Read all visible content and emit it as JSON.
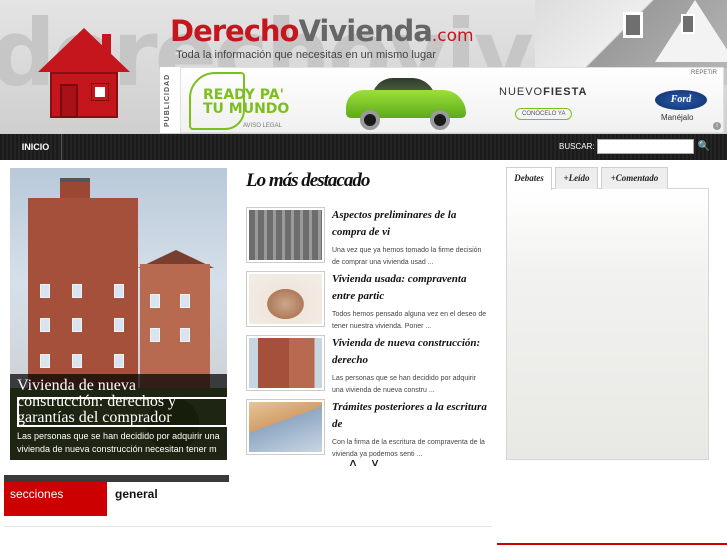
{
  "header": {
    "bg_watermark": "derechoviviend",
    "brand_part1": "Derecho",
    "brand_part2": "Vivienda",
    "brand_suffix": ".com",
    "tagline": "Toda la información que necesitas en un mismo lugar"
  },
  "ad": {
    "label": "PUBLICIDAD",
    "slogan": "READY PA'\nTU MUNDO",
    "legal": "AVISO LEGAL",
    "model_prefix": "NUEVO",
    "model_name": "FIESTA",
    "cta": "CONÓCELO YA",
    "repeat": "REPETIR",
    "brand": "Ford",
    "brand_tagline": "Manéjalo",
    "info_icon": "i"
  },
  "nav": {
    "home": "INICIO",
    "search_label": "BUSCAR:",
    "search_value": "",
    "search_icon": "🔍"
  },
  "featured": {
    "title": "Vivienda de nueva construcción: derechos y garantías del comprador",
    "description": "Las personas que se han decidido por adquirir una vivienda de nueva construcción necesitan tener m"
  },
  "highlights": {
    "heading": "Lo más destacado",
    "articles": [
      {
        "title": "Aspectos preliminares de la compra de vi",
        "desc": "Una vez que ya hemos tomado la firme decisión de comprar una vivienda usad ...",
        "thumb": "building-thumb"
      },
      {
        "title": "Vivienda usada: compraventa entre partic",
        "desc": "Todos hemos pensado alguna vez en el deseo de tener nuestra vivienda. Poner ...",
        "thumb": "money-house-thumb"
      },
      {
        "title": "Vivienda de nueva construcción: derecho",
        "desc": "Las personas que se han decidido por adquirir una vivienda de nueva constru ...",
        "thumb": "brick-building-thumb"
      },
      {
        "title": "Trámites posteriores a la escritura de",
        "desc": "Con la firma de la escritura de compraventa de la vivienda ya podemos senti ...",
        "thumb": "euro-house-thumb"
      }
    ],
    "prev_icon": "˄",
    "next_icon": "˅"
  },
  "tabs": {
    "items": [
      "Debates",
      "+Leído",
      "+Comentado"
    ]
  },
  "sections": {
    "label": "secciones",
    "value": "general"
  },
  "colors": {
    "brand_red": "#c4161c",
    "section_red": "#cc0000",
    "ad_green": "#7cbf1e"
  }
}
